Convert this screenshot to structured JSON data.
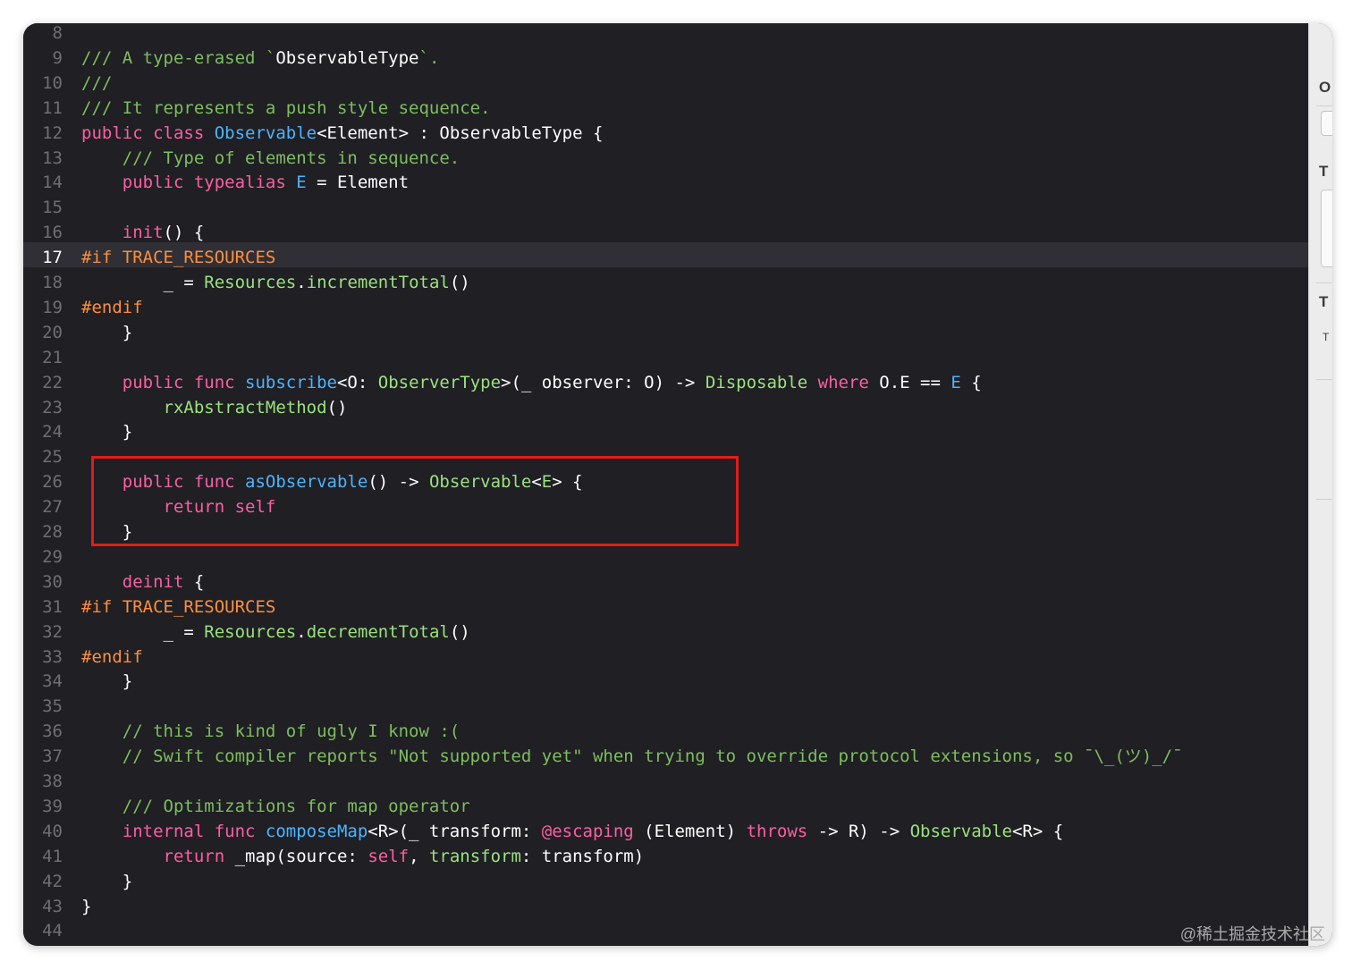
{
  "editor": {
    "current_line": "17",
    "lines": [
      {
        "n": "8",
        "segments": []
      },
      {
        "n": "9",
        "segments": [
          {
            "t": "/// A type-erased `",
            "c": "c-comment"
          },
          {
            "t": "ObservableType",
            "c": "c-bracket"
          },
          {
            "t": "`.",
            "c": "c-comment"
          }
        ]
      },
      {
        "n": "10",
        "segments": [
          {
            "t": "///",
            "c": "c-comment"
          }
        ]
      },
      {
        "n": "11",
        "segments": [
          {
            "t": "/// It represents a push style sequence.",
            "c": "c-comment"
          }
        ]
      },
      {
        "n": "12",
        "segments": [
          {
            "t": "public class ",
            "c": "c-kw"
          },
          {
            "t": "Observable",
            "c": "c-type"
          },
          {
            "t": "<Element> : ObservableType {",
            "c": ""
          }
        ]
      },
      {
        "n": "13",
        "segments": [
          {
            "t": "    /// Type of elements in sequence.",
            "c": "c-comment"
          }
        ]
      },
      {
        "n": "14",
        "segments": [
          {
            "t": "    public typealias ",
            "c": "c-kw"
          },
          {
            "t": "E",
            "c": "c-type"
          },
          {
            "t": " = Element",
            "c": ""
          }
        ]
      },
      {
        "n": "15",
        "segments": []
      },
      {
        "n": "16",
        "segments": [
          {
            "t": "    init",
            "c": "c-kw"
          },
          {
            "t": "() {",
            "c": ""
          }
        ]
      },
      {
        "n": "17",
        "segments": [
          {
            "t": "#if TRACE_RESOURCES",
            "c": "c-pp"
          }
        ]
      },
      {
        "n": "18",
        "segments": [
          {
            "t": "        _ = ",
            "c": ""
          },
          {
            "t": "Resources",
            "c": "c-green"
          },
          {
            "t": ".",
            "c": ""
          },
          {
            "t": "incrementTotal",
            "c": "c-green"
          },
          {
            "t": "()",
            "c": ""
          }
        ]
      },
      {
        "n": "19",
        "segments": [
          {
            "t": "#endif",
            "c": "c-pp"
          }
        ]
      },
      {
        "n": "20",
        "segments": [
          {
            "t": "    }",
            "c": ""
          }
        ]
      },
      {
        "n": "21",
        "segments": []
      },
      {
        "n": "22",
        "segments": [
          {
            "t": "    public func ",
            "c": "c-kw"
          },
          {
            "t": "subscribe",
            "c": "c-type"
          },
          {
            "t": "<O: ",
            "c": ""
          },
          {
            "t": "ObserverType",
            "c": "c-green"
          },
          {
            "t": ">(_ observer: O) -> ",
            "c": ""
          },
          {
            "t": "Disposable",
            "c": "c-green"
          },
          {
            "t": " where ",
            "c": "c-kw"
          },
          {
            "t": "O.E == ",
            "c": ""
          },
          {
            "t": "E",
            "c": "c-type"
          },
          {
            "t": " {",
            "c": ""
          }
        ]
      },
      {
        "n": "23",
        "segments": [
          {
            "t": "        rxAbstractMethod",
            "c": "c-green"
          },
          {
            "t": "()",
            "c": ""
          }
        ]
      },
      {
        "n": "24",
        "segments": [
          {
            "t": "    }",
            "c": ""
          }
        ]
      },
      {
        "n": "25",
        "segments": []
      },
      {
        "n": "26",
        "segments": [
          {
            "t": "    public func ",
            "c": "c-kw"
          },
          {
            "t": "asObservable",
            "c": "c-type"
          },
          {
            "t": "() -> ",
            "c": ""
          },
          {
            "t": "Observable",
            "c": "c-green"
          },
          {
            "t": "<",
            "c": ""
          },
          {
            "t": "E",
            "c": "c-green"
          },
          {
            "t": "> {",
            "c": ""
          }
        ]
      },
      {
        "n": "27",
        "segments": [
          {
            "t": "        return self",
            "c": "c-kw"
          }
        ]
      },
      {
        "n": "28",
        "segments": [
          {
            "t": "    }",
            "c": ""
          }
        ]
      },
      {
        "n": "29",
        "segments": []
      },
      {
        "n": "30",
        "segments": [
          {
            "t": "    deinit",
            "c": "c-kw"
          },
          {
            "t": " {",
            "c": ""
          }
        ]
      },
      {
        "n": "31",
        "segments": [
          {
            "t": "#if TRACE_RESOURCES",
            "c": "c-pp"
          }
        ]
      },
      {
        "n": "32",
        "segments": [
          {
            "t": "        _ = ",
            "c": ""
          },
          {
            "t": "Resources",
            "c": "c-green"
          },
          {
            "t": ".",
            "c": ""
          },
          {
            "t": "decrementTotal",
            "c": "c-green"
          },
          {
            "t": "()",
            "c": ""
          }
        ]
      },
      {
        "n": "33",
        "segments": [
          {
            "t": "#endif",
            "c": "c-pp"
          }
        ]
      },
      {
        "n": "34",
        "segments": [
          {
            "t": "    }",
            "c": ""
          }
        ]
      },
      {
        "n": "35",
        "segments": []
      },
      {
        "n": "36",
        "segments": [
          {
            "t": "    // this is kind of ugly I know :(",
            "c": "c-comment"
          }
        ]
      },
      {
        "n": "37",
        "segments": [
          {
            "t": "    // Swift compiler reports \"Not supported yet\" when trying to override protocol extensions, so ¯\\_(ツ)_/¯",
            "c": "c-comment"
          }
        ]
      },
      {
        "n": "38",
        "segments": []
      },
      {
        "n": "39",
        "segments": [
          {
            "t": "    /// Optimizations for map operator",
            "c": "c-comment"
          }
        ]
      },
      {
        "n": "40",
        "segments": [
          {
            "t": "    internal func ",
            "c": "c-kw"
          },
          {
            "t": "composeMap",
            "c": "c-type"
          },
          {
            "t": "<R>(_ transform: ",
            "c": ""
          },
          {
            "t": "@escaping",
            "c": "c-kw"
          },
          {
            "t": " (Element) ",
            "c": ""
          },
          {
            "t": "throws",
            "c": "c-kw"
          },
          {
            "t": " -> R) -> ",
            "c": ""
          },
          {
            "t": "Observable",
            "c": "c-green"
          },
          {
            "t": "<R> {",
            "c": ""
          }
        ]
      },
      {
        "n": "41",
        "segments": [
          {
            "t": "        return ",
            "c": "c-kw"
          },
          {
            "t": "_map(source: ",
            "c": ""
          },
          {
            "t": "self",
            "c": "c-kw"
          },
          {
            "t": ", ",
            "c": ""
          },
          {
            "t": "transform",
            "c": "c-green"
          },
          {
            "t": ": transform)",
            "c": ""
          }
        ]
      },
      {
        "n": "42",
        "segments": [
          {
            "t": "    }",
            "c": ""
          }
        ]
      },
      {
        "n": "43",
        "segments": [
          {
            "t": "}",
            "c": ""
          }
        ]
      },
      {
        "n": "44",
        "segments": []
      }
    ]
  },
  "side_panel": {
    "letters": [
      "O",
      "T",
      "T"
    ],
    "minor": "T"
  },
  "watermark": "@稀土掘金技术社区",
  "colors": {
    "background": "#1f1f24",
    "comment": "#7ebe5e",
    "keyword": "#fc5fa3",
    "type": "#4cb4ff",
    "preprocessor": "#fd8f3f",
    "highlight_box": "#e31b1b"
  }
}
